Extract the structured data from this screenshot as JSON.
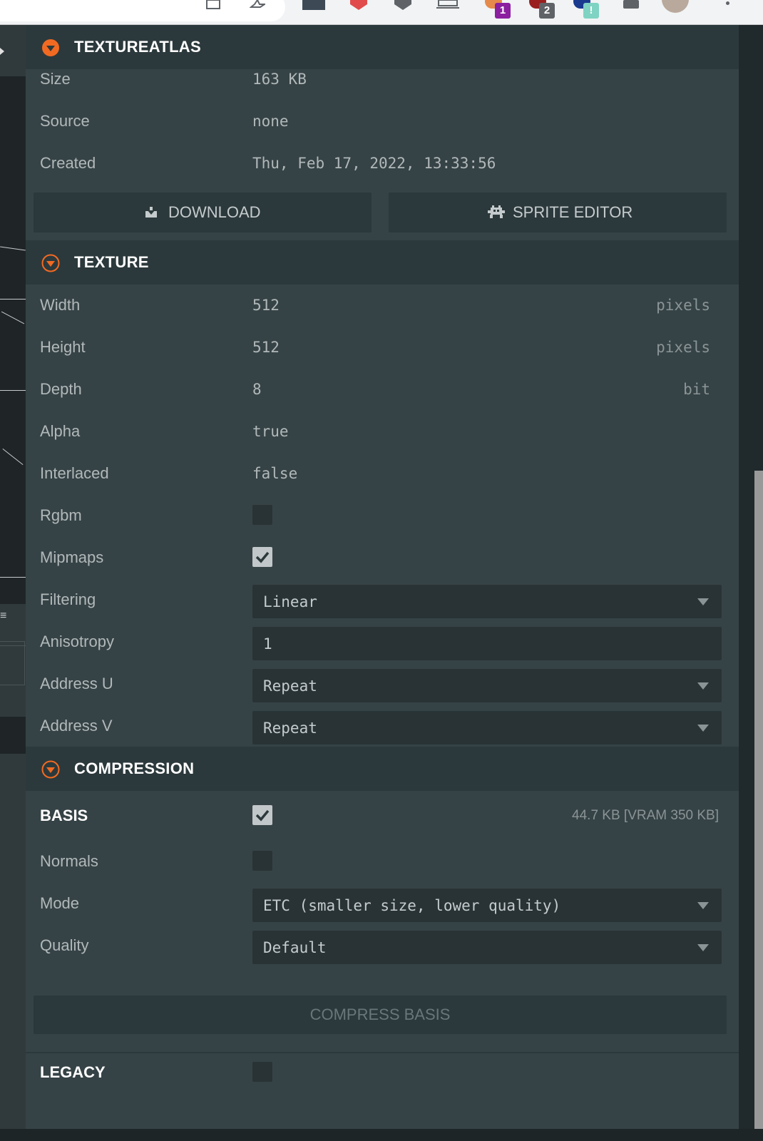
{
  "browser": {
    "badges": [
      "1",
      "2",
      "!"
    ]
  },
  "textureatlas": {
    "title": "TEXTUREATLAS",
    "rows": [
      {
        "label": "Size",
        "value": "163 KB"
      },
      {
        "label": "Source",
        "value": "none"
      },
      {
        "label": "Created",
        "value": "Thu, Feb 17, 2022, 13:33:56"
      }
    ],
    "download_label": "DOWNLOAD",
    "sprite_editor_label": "SPRITE EDITOR"
  },
  "texture": {
    "title": "TEXTURE",
    "width": {
      "label": "Width",
      "value": "512",
      "unit": "pixels"
    },
    "height": {
      "label": "Height",
      "value": "512",
      "unit": "pixels"
    },
    "depth": {
      "label": "Depth",
      "value": "8",
      "unit": "bit"
    },
    "alpha": {
      "label": "Alpha",
      "value": "true"
    },
    "interlaced": {
      "label": "Interlaced",
      "value": "false"
    },
    "rgbm": {
      "label": "Rgbm",
      "checked": false
    },
    "mipmaps": {
      "label": "Mipmaps",
      "checked": true
    },
    "filtering": {
      "label": "Filtering",
      "value": "Linear"
    },
    "anisotropy": {
      "label": "Anisotropy",
      "value": "1"
    },
    "address_u": {
      "label": "Address U",
      "value": "Repeat"
    },
    "address_v": {
      "label": "Address V",
      "value": "Repeat"
    }
  },
  "compression": {
    "title": "COMPRESSION",
    "basis": {
      "label": "BASIS",
      "checked": true,
      "size_info": "44.7 KB [VRAM 350 KB]"
    },
    "normals": {
      "label": "Normals",
      "checked": false
    },
    "mode": {
      "label": "Mode",
      "value": "ETC (smaller size, lower quality)"
    },
    "quality": {
      "label": "Quality",
      "value": "Default"
    },
    "compress_basis_label": "COMPRESS BASIS",
    "legacy": {
      "label": "LEGACY",
      "checked": false
    }
  },
  "colors": {
    "accent": "#f26a22",
    "panel": "#364346",
    "header": "#2c393c",
    "field": "#293336"
  }
}
